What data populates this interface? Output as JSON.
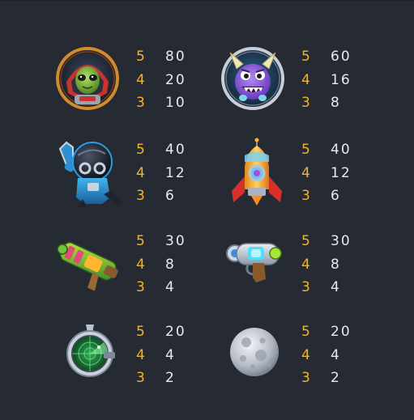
{
  "colors": {
    "background": "#262a33",
    "count_color": "#f3b52a",
    "value_color": "#e7e9ee"
  },
  "symbols": [
    {
      "icon": "alien-astronaut-icon",
      "payouts": [
        {
          "count": "5",
          "value": "80"
        },
        {
          "count": "4",
          "value": "20"
        },
        {
          "count": "3",
          "value": "10"
        }
      ]
    },
    {
      "icon": "purple-monster-icon",
      "payouts": [
        {
          "count": "5",
          "value": "60"
        },
        {
          "count": "4",
          "value": "16"
        },
        {
          "count": "3",
          "value": "8"
        }
      ]
    },
    {
      "icon": "robot-astronaut-icon",
      "payouts": [
        {
          "count": "5",
          "value": "40"
        },
        {
          "count": "4",
          "value": "12"
        },
        {
          "count": "3",
          "value": "6"
        }
      ]
    },
    {
      "icon": "rocket-icon",
      "payouts": [
        {
          "count": "5",
          "value": "40"
        },
        {
          "count": "4",
          "value": "12"
        },
        {
          "count": "3",
          "value": "6"
        }
      ]
    },
    {
      "icon": "green-blaster-icon",
      "payouts": [
        {
          "count": "5",
          "value": "30"
        },
        {
          "count": "4",
          "value": "8"
        },
        {
          "count": "3",
          "value": "4"
        }
      ]
    },
    {
      "icon": "ray-gun-icon",
      "payouts": [
        {
          "count": "5",
          "value": "30"
        },
        {
          "count": "4",
          "value": "8"
        },
        {
          "count": "3",
          "value": "4"
        }
      ]
    },
    {
      "icon": "radar-icon",
      "payouts": [
        {
          "count": "5",
          "value": "20"
        },
        {
          "count": "4",
          "value": "4"
        },
        {
          "count": "3",
          "value": "2"
        }
      ]
    },
    {
      "icon": "moon-icon",
      "payouts": [
        {
          "count": "5",
          "value": "20"
        },
        {
          "count": "4",
          "value": "4"
        },
        {
          "count": "3",
          "value": "2"
        }
      ]
    }
  ]
}
